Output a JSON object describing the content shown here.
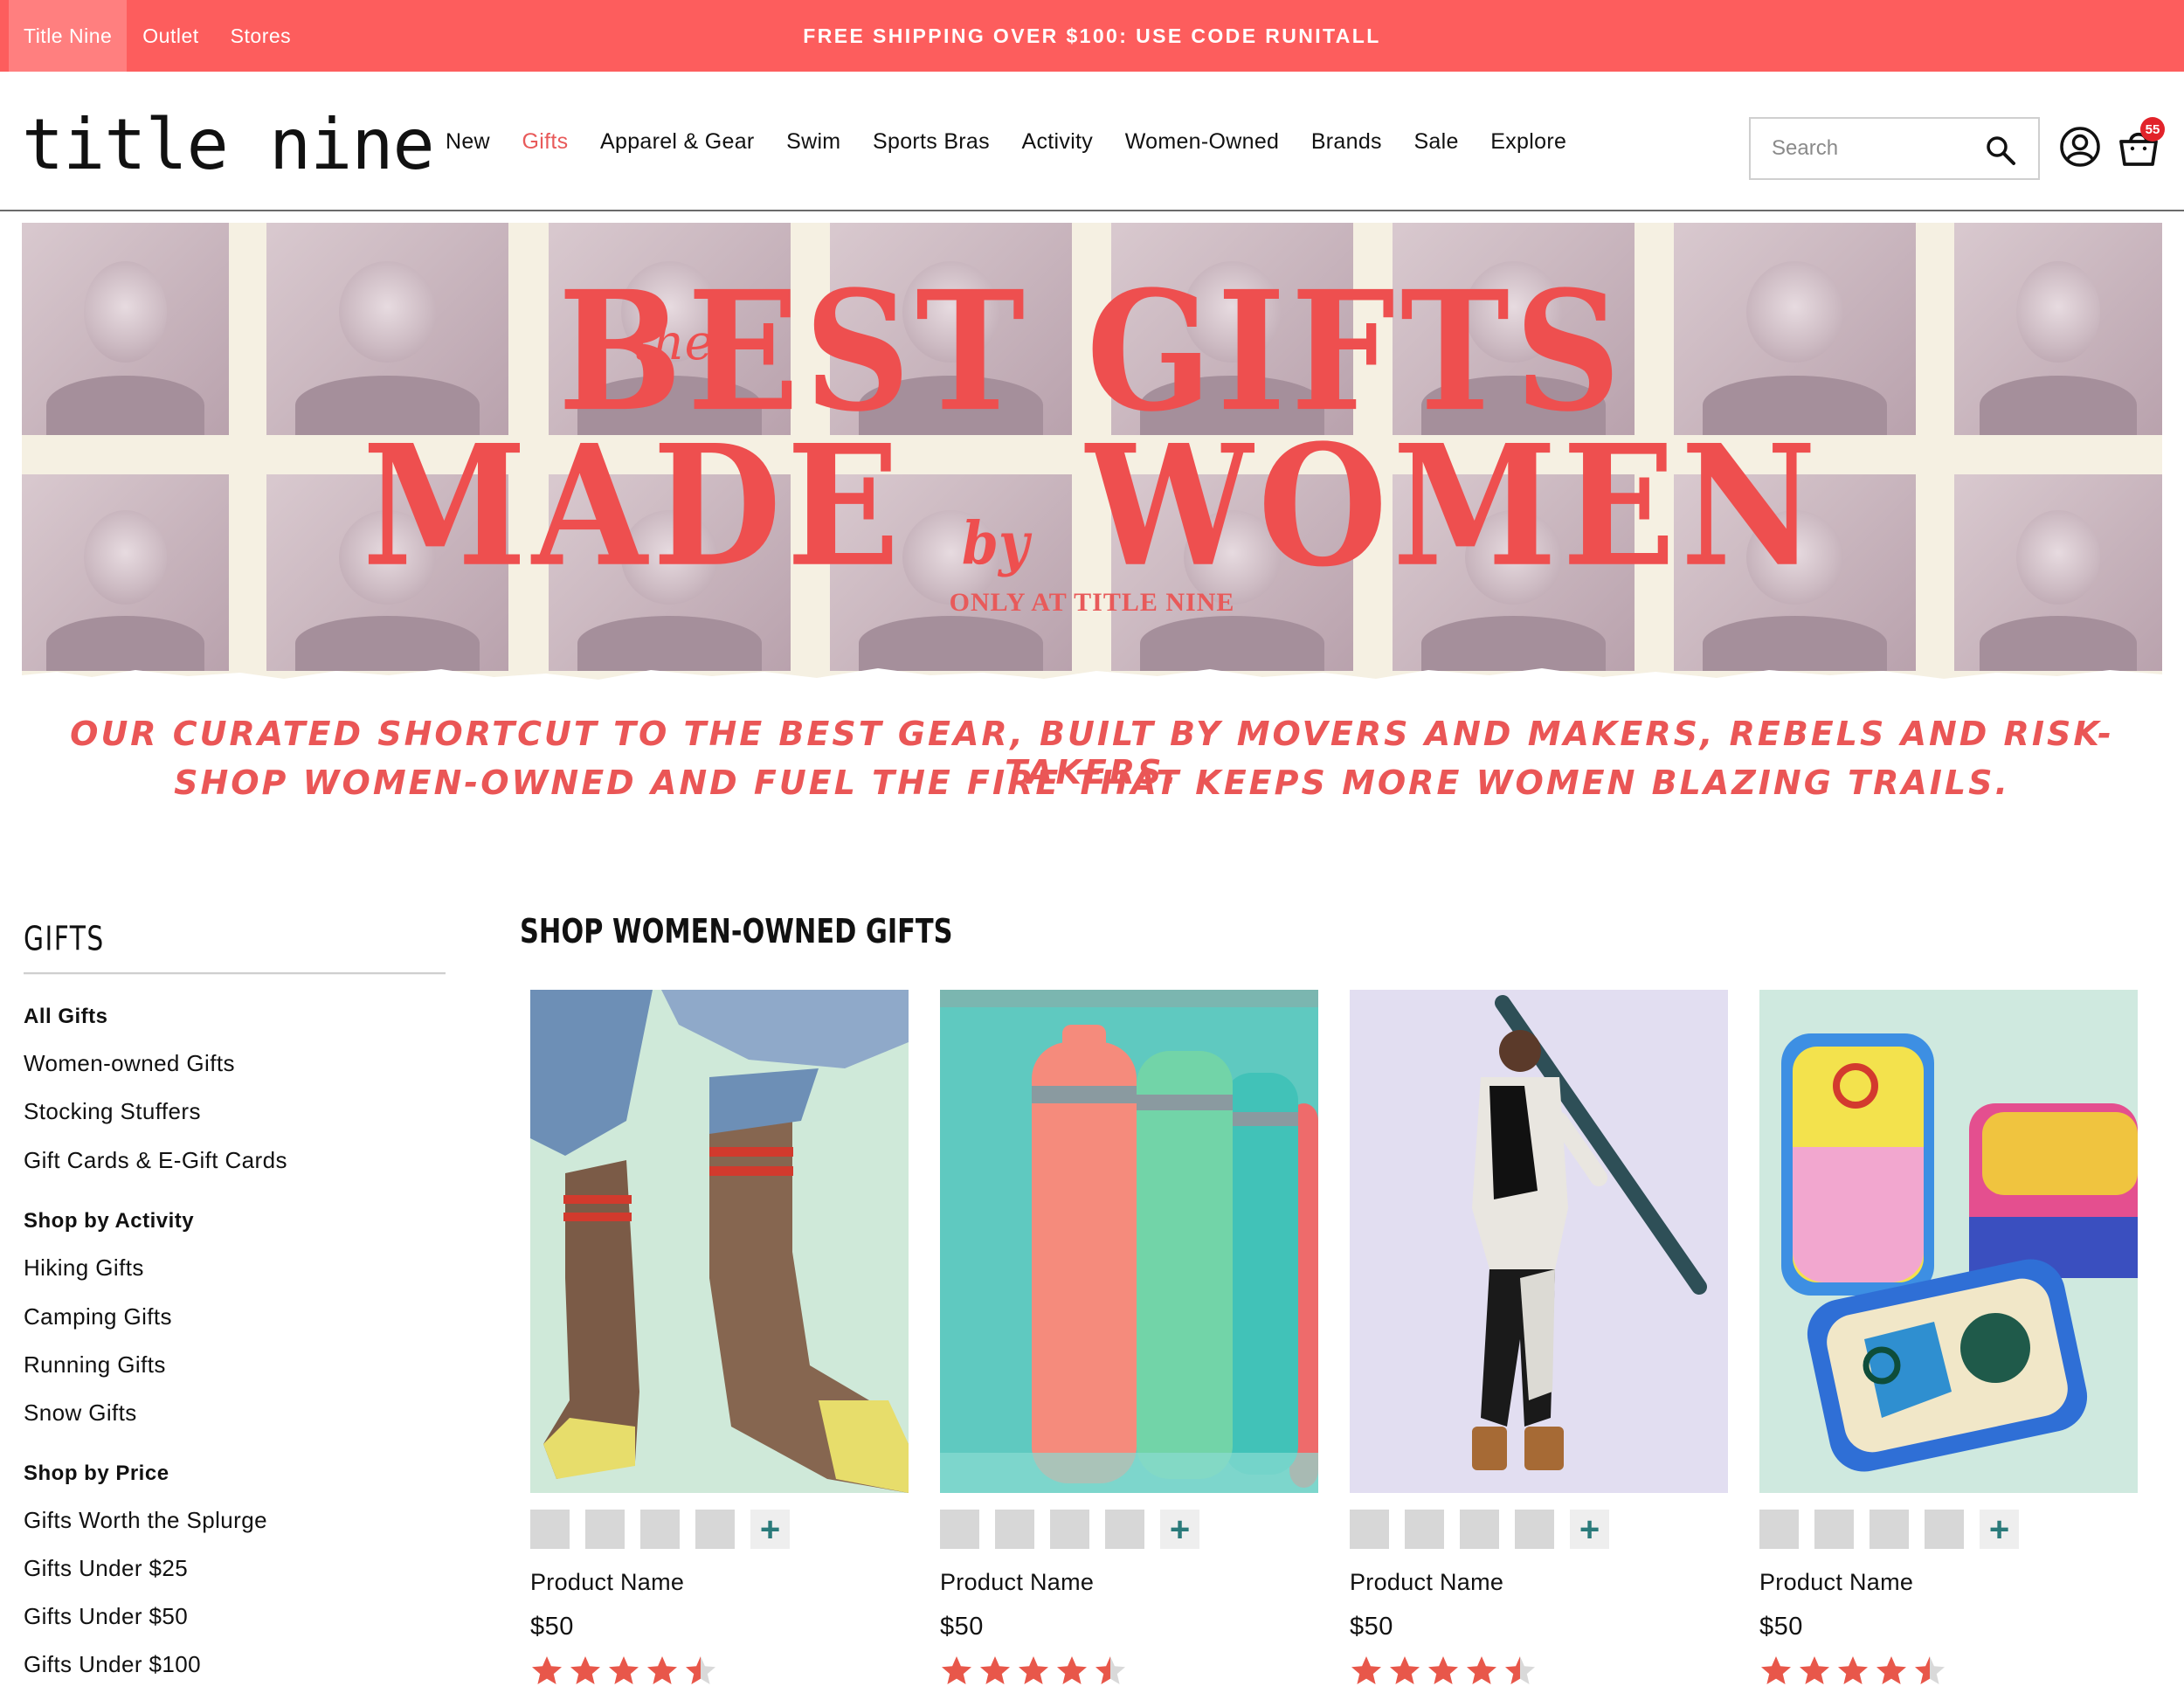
{
  "topbar": {
    "sites": [
      "Title Nine",
      "Outlet",
      "Stores"
    ],
    "promo": "FREE SHIPPING OVER $100: USE CODE RUNITALL"
  },
  "header": {
    "logo": "title nine",
    "nav": [
      "New",
      "Gifts",
      "Apparel & Gear",
      "Swim",
      "Sports Bras",
      "Activity",
      "Women-Owned",
      "Brands",
      "Sale",
      "Explore"
    ],
    "active_nav": "Gifts",
    "search_placeholder": "Search",
    "cart_count": "55",
    "icons": {
      "search": "search-icon",
      "account": "account-icon",
      "cart": "cart-icon"
    }
  },
  "hero": {
    "the": "the",
    "line1": "BEST GIFTS",
    "line2_a": "MADE",
    "by": "by",
    "line2_b": "WOMEN",
    "sub": "ONLY AT TITLE NINE"
  },
  "tagline": {
    "line1": "OUR CURATED SHORTCUT TO THE  BEST GEAR, BUILT BY MOVERS AND MAKERS, REBELS AND RISK-TAKERS.",
    "line2": "SHOP WOMEN-OWNED AND FUEL THE FIRE THAT KEEPS MORE WOMEN BLAZING TRAILS."
  },
  "sidebar": {
    "title": "GIFTS",
    "groups": [
      {
        "heading": "All Gifts",
        "items": [
          "Women-owned Gifts",
          "Stocking Stuffers",
          "Gift Cards & E-Gift Cards"
        ]
      },
      {
        "heading": "Shop by Activity",
        "items": [
          "Hiking Gifts",
          "Camping Gifts",
          "Running Gifts",
          "Snow Gifts"
        ]
      },
      {
        "heading": "Shop by Price",
        "items": [
          "Gifts Worth the Splurge",
          "Gifts Under $25",
          "Gifts Under $50",
          "Gifts Under $100"
        ]
      }
    ]
  },
  "products": {
    "title": "SHOP WOMEN-OWNED GIFTS",
    "items": [
      {
        "name": "Product Name",
        "price": "$50",
        "rating": 4.5,
        "image": "socks"
      },
      {
        "name": "Product Name",
        "price": "$50",
        "rating": 4.5,
        "image": "water-bottles"
      },
      {
        "name": "Product Name",
        "price": "$50",
        "rating": 4.5,
        "image": "ski-base-layer"
      },
      {
        "name": "Product Name",
        "price": "$50",
        "rating": 4.5,
        "image": "tin-cans"
      }
    ],
    "swatch_more": "+"
  },
  "colors": {
    "brand_red": "#fd5d5d",
    "accent_coral": "#ee4f4f",
    "star": "#e8574a",
    "badge": "#e2232a"
  }
}
